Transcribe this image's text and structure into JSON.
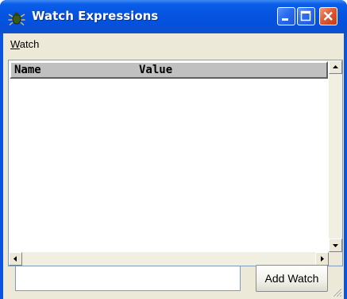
{
  "window": {
    "title": "Watch Expressions",
    "colors": {
      "title_bar": "#0553e0",
      "client": "#ece9d8",
      "close_button": "#e05a34"
    }
  },
  "titlebar": {
    "app_icon": "bug-icon",
    "buttons": [
      {
        "name": "minimize",
        "icon": "minimize-icon"
      },
      {
        "name": "maximize",
        "icon": "maximize-icon"
      },
      {
        "name": "close",
        "icon": "close-icon"
      }
    ]
  },
  "menubar": {
    "items": [
      {
        "label": "Watch",
        "mnemonic": "W",
        "rest": "atch"
      }
    ]
  },
  "watch_list": {
    "columns": [
      {
        "label": "Name"
      },
      {
        "label": "Value"
      }
    ],
    "rows": []
  },
  "scrollbars": {
    "vertical": {
      "up_icon": "arrow-up-icon",
      "down_icon": "arrow-down-icon"
    },
    "horizontal": {
      "left_icon": "arrow-left-icon",
      "right_icon": "arrow-right-icon"
    }
  },
  "footer": {
    "expression_input": {
      "value": "",
      "placeholder": ""
    },
    "add_button_label": "Add Watch"
  }
}
